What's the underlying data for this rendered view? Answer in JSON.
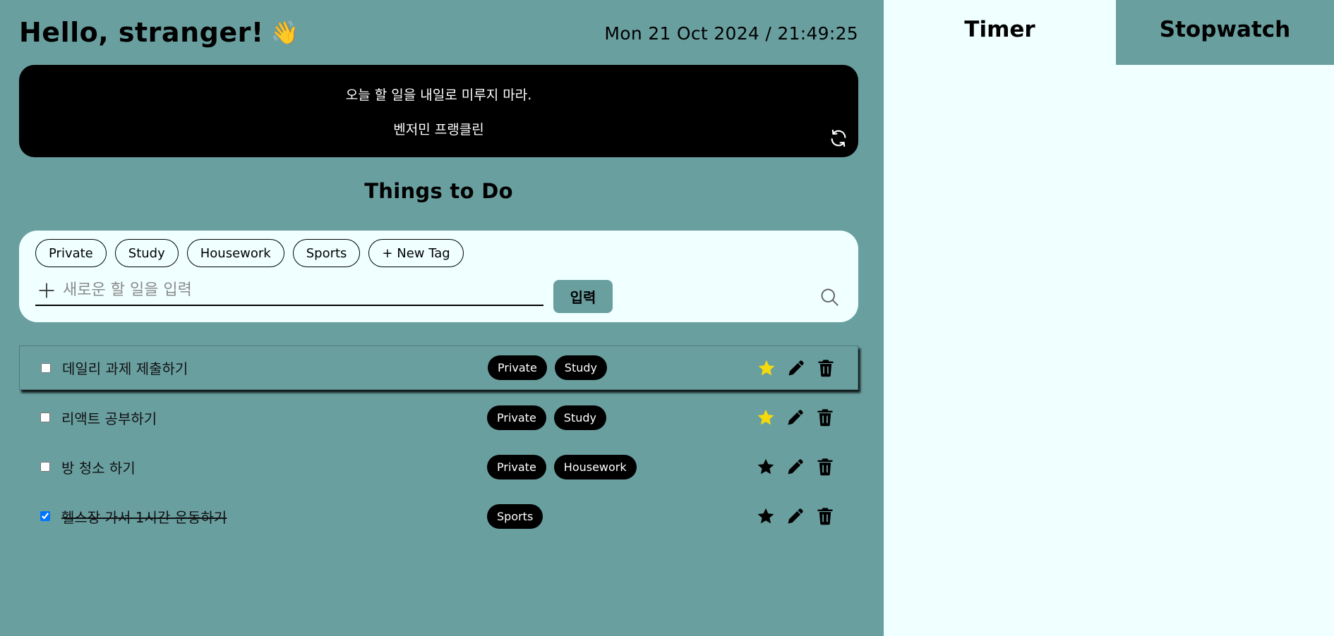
{
  "header": {
    "greeting": "Hello, stranger!",
    "wave_emoji": "👋",
    "datetime": "Mon 21 Oct 2024 / 21:49:25"
  },
  "quote": {
    "text": "오늘 할 일을 내일로 미루지 마라.",
    "author": "벤저민 프랭클린",
    "refresh_icon": "refresh-icon"
  },
  "section_title": "Things to Do",
  "tags": [
    "Private",
    "Study",
    "Housework",
    "Sports",
    "+ New Tag"
  ],
  "input": {
    "placeholder": "새로운 할 일을 입력",
    "value": "",
    "submit_label": "입력"
  },
  "todos": [
    {
      "text": "데일리 과제 제출하기",
      "checked": false,
      "tags": [
        "Private",
        "Study"
      ],
      "starred": true,
      "selected": true
    },
    {
      "text": "리액트 공부하기",
      "checked": false,
      "tags": [
        "Private",
        "Study"
      ],
      "starred": true,
      "selected": false
    },
    {
      "text": "방 청소 하기",
      "checked": false,
      "tags": [
        "Private",
        "Housework"
      ],
      "starred": false,
      "selected": false
    },
    {
      "text": "헬스장 가서 1시간 운동하기",
      "checked": true,
      "tags": [
        "Sports"
      ],
      "starred": false,
      "selected": false
    }
  ],
  "side_tabs": {
    "timer": "Timer",
    "stopwatch": "Stopwatch",
    "active": "Timer"
  },
  "colors": {
    "background": "#6a9fa0",
    "panel": "#f0ffff",
    "star_active": "#f5d90a",
    "quote_bg": "#000000"
  }
}
